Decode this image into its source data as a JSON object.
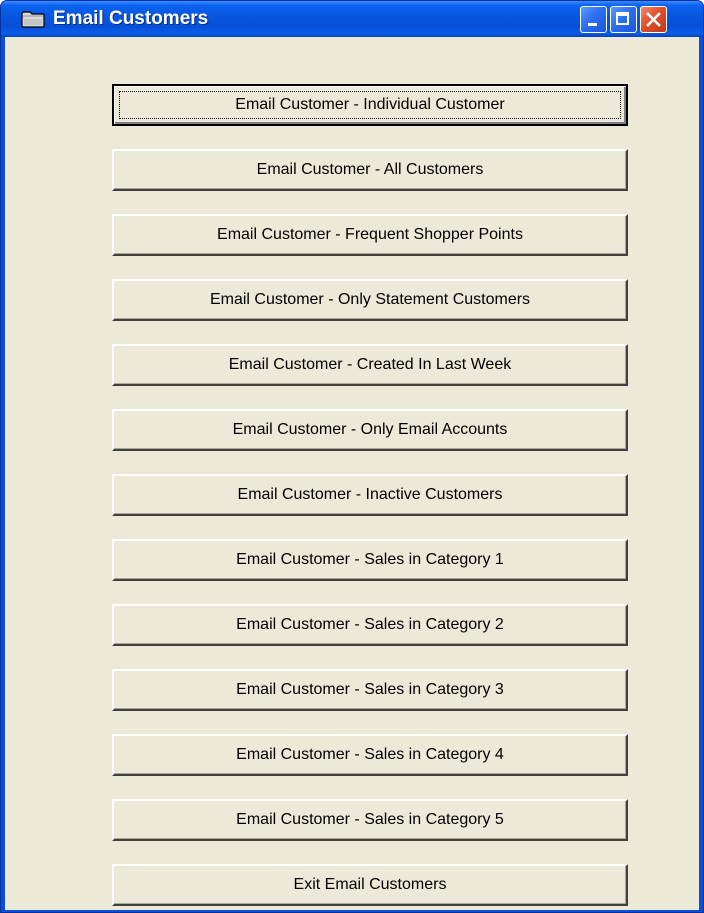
{
  "window": {
    "title": "Email Customers",
    "icon": "folder-icon",
    "controls": {
      "minimize": "minimize-icon",
      "maximize": "maximize-icon",
      "close": "close-icon"
    },
    "colors": {
      "titlebar": "#0855dd",
      "client": "#ece9d8",
      "close_button": "#e0502a"
    }
  },
  "buttons": [
    {
      "label": "Email Customer - Individual Customer",
      "focused": true
    },
    {
      "label": "Email Customer - All Customers"
    },
    {
      "label": "Email Customer - Frequent Shopper Points"
    },
    {
      "label": "Email Customer - Only Statement Customers"
    },
    {
      "label": "Email Customer - Created In Last Week"
    },
    {
      "label": "Email Customer - Only Email Accounts"
    },
    {
      "label": "Email Customer - Inactive Customers"
    },
    {
      "label": "Email Customer - Sales in Category 1"
    },
    {
      "label": "Email Customer - Sales in Category 2"
    },
    {
      "label": "Email Customer - Sales in Category 3"
    },
    {
      "label": "Email Customer - Sales in Category 4"
    },
    {
      "label": "Email Customer - Sales in Category 5"
    },
    {
      "label": "Exit Email Customers"
    }
  ]
}
